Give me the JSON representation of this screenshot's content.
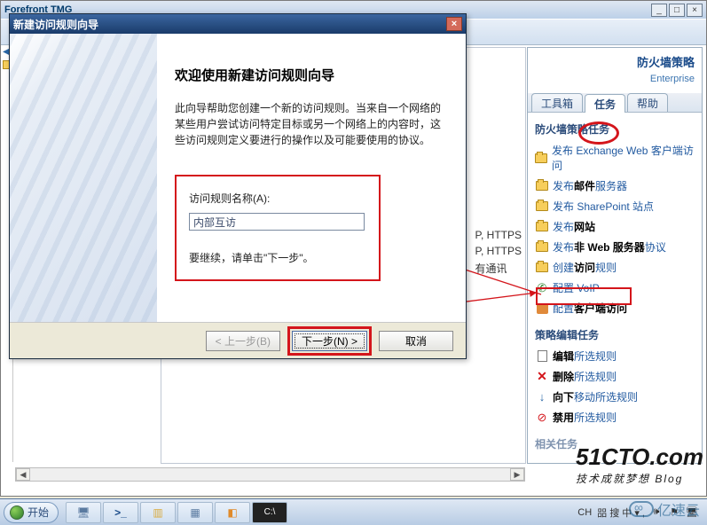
{
  "app": {
    "title": "Forefront TMG",
    "min": "_",
    "max": "□",
    "close": "×"
  },
  "right": {
    "header_title": "防火墙策略",
    "header_sub": "Enterprise",
    "tabs": [
      "工具箱",
      "任务",
      "帮助"
    ],
    "section1": "防火墙策略任务",
    "tasks1": [
      "发布 Exchange Web 客户端访问",
      "发布邮件服务器",
      "发布 SharePoint 站点",
      "发布网站",
      "发布非 Web 服务器协议",
      "创建访问规则",
      "配置 VoIP",
      "配置客户端访问"
    ],
    "section2": "策略编辑任务",
    "tasks2": [
      "编辑所选规则",
      "删除所选规则",
      "向下移动所选规则",
      "禁用所选规则"
    ],
    "section3": "相关任务"
  },
  "mid": {
    "line1": "P, HTTPS",
    "line2": "P, HTTPS",
    "line3": "有通讯"
  },
  "wizard": {
    "title": "新建访问规则向导",
    "close": "×",
    "heading": "欢迎使用新建访问规则向导",
    "para": "此向导帮助您创建一个新的访问规则。当来自一个网络的某些用户尝试访问特定目标或另一个网络上的内容时，这些访问规则定义要进行的操作以及可能要使用的协议。",
    "form_label": "访问规则名称(A):",
    "form_value": "内部互访",
    "form_hint": "要继续，请单击\"下一步\"。",
    "btn_back": "< 上一步(B)",
    "btn_next": "下一步(N) >",
    "btn_cancel": "取消"
  },
  "taskbar": {
    "start": "开始",
    "ch": "CH",
    "ime": "㗊 搜 中 ▾ ,",
    "cmd": "C:\\"
  },
  "watermark": {
    "main": "51CTO.com",
    "sub": "技术成就梦想 Blog",
    "brand": "亿速云"
  }
}
